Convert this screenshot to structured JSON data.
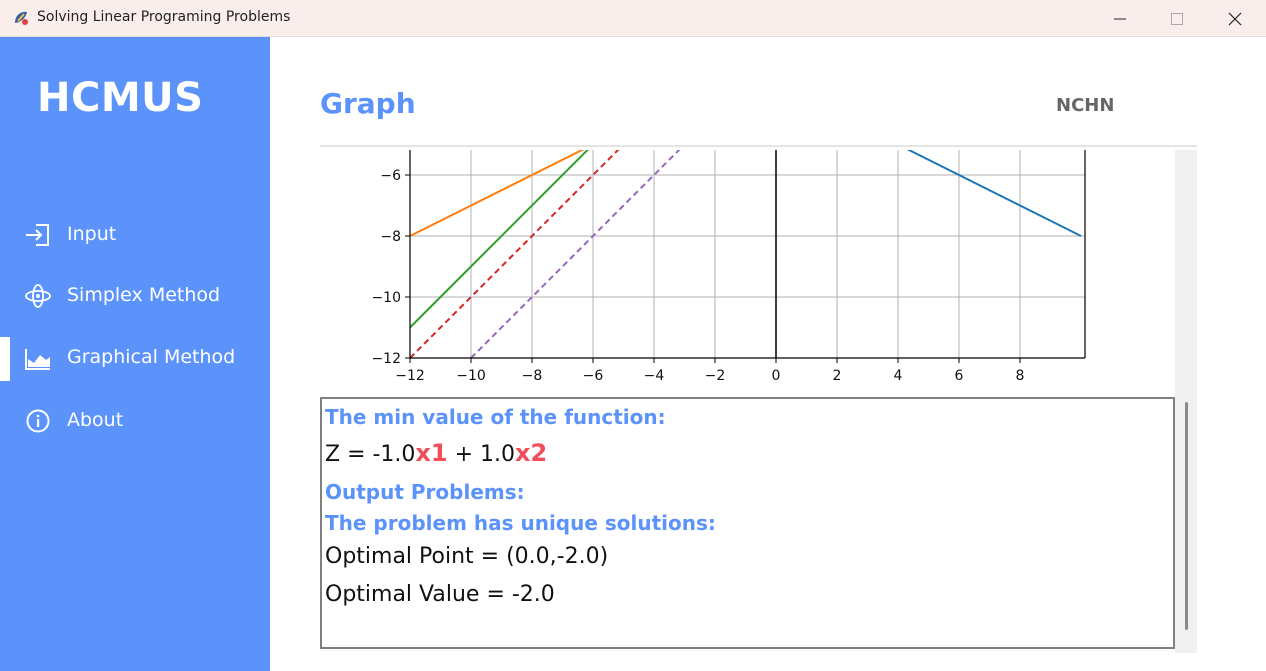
{
  "window": {
    "title": "Solving Linear Programing Problems"
  },
  "sidebar": {
    "brand": "HCMUS",
    "items": [
      {
        "label": "Input",
        "icon": "login-icon"
      },
      {
        "label": "Simplex Method",
        "icon": "orbit-icon"
      },
      {
        "label": "Graphical Method",
        "icon": "area-chart-icon",
        "active": true
      },
      {
        "label": "About",
        "icon": "info-icon"
      }
    ]
  },
  "header": {
    "title": "Graph",
    "user": "NCHN"
  },
  "colors": {
    "accent": "#5b93fb",
    "variable": "#f24d5b"
  },
  "chart_data": {
    "type": "line",
    "xticks": [
      "−12",
      "−10",
      "−8",
      "−6",
      "−4",
      "−2",
      "0",
      "2",
      "4",
      "6",
      "8"
    ],
    "yticks": [
      "−6",
      "−8",
      "−10",
      "−12"
    ],
    "xlim": [
      -12,
      10
    ],
    "ylim": [
      -12,
      -5.2
    ],
    "grid": true,
    "series": [
      {
        "color": "#ff7f0e",
        "style": "solid",
        "points": [
          [
            -12,
            -8
          ],
          [
            -6,
            -5
          ]
        ]
      },
      {
        "color": "#2ca02c",
        "style": "solid",
        "points": [
          [
            -12,
            -11
          ],
          [
            -6,
            -5
          ]
        ]
      },
      {
        "color": "#d62728",
        "style": "dashed",
        "points": [
          [
            -12,
            -12
          ],
          [
            -5,
            -5
          ]
        ]
      },
      {
        "color": "#9467bd",
        "style": "dashed",
        "points": [
          [
            -10,
            -12
          ],
          [
            -3,
            -5
          ]
        ]
      },
      {
        "color": "#1f77b4",
        "style": "solid",
        "points": [
          [
            4,
            -5
          ],
          [
            10,
            -8
          ]
        ]
      },
      {
        "color": "#000000",
        "style": "solid",
        "points": [
          [
            0,
            -12
          ],
          [
            0,
            -5
          ]
        ]
      }
    ]
  },
  "result": {
    "min_heading": "The min value of the function:",
    "z_prefix": "Z = -1.0",
    "x1": "x",
    "x1_sub": "1",
    "z_mid": " + 1.0",
    "x2": "x",
    "x2_sub": "2",
    "output_heading": "Output Problems:",
    "status": "The problem has unique solutions:",
    "optimal_point": "Optimal Point = (0.0,-2.0)",
    "optimal_value": "Optimal Value = -2.0"
  }
}
